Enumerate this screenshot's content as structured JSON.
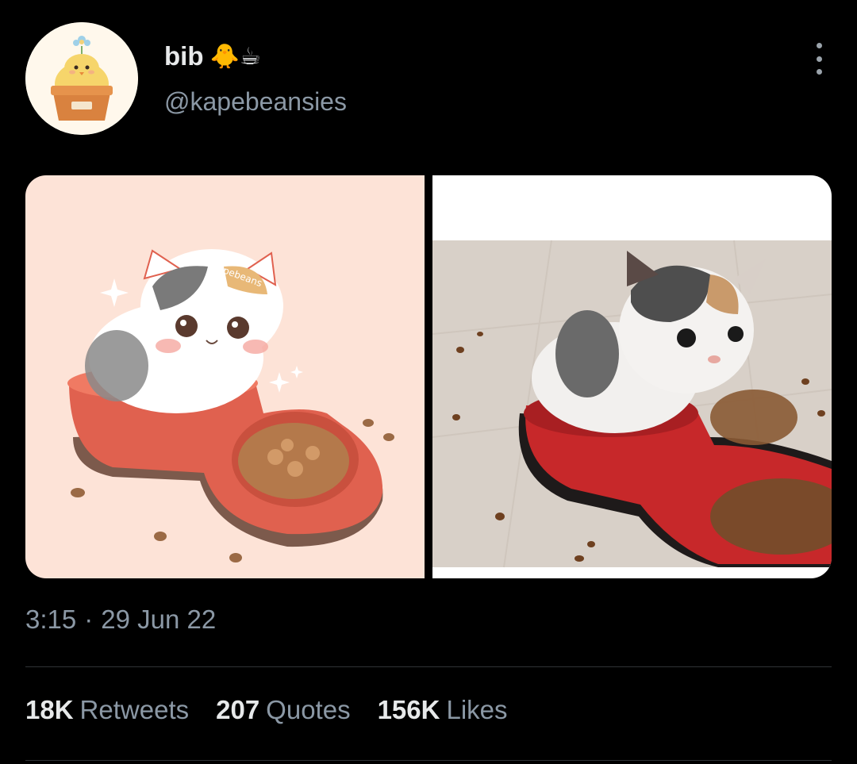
{
  "author": {
    "display_name": "bib",
    "name_emoji": "🐥☕",
    "handle": "@kapebeansies",
    "avatar_icon": "chick-in-flowerpot-avatar"
  },
  "media": {
    "left_image": "calico-kitten-illustration-in-red-bowl",
    "left_watermark": "kapebeans",
    "right_image": "calico-kitten-photo-in-red-bowl"
  },
  "timestamp": {
    "time": "3:15",
    "separator": "·",
    "date": "29 Jun 22"
  },
  "stats": [
    {
      "count": "18K",
      "label": "Retweets"
    },
    {
      "count": "207",
      "label": "Quotes"
    },
    {
      "count": "156K",
      "label": "Likes"
    }
  ],
  "colors": {
    "background": "#000000",
    "primary_text": "#e7e9ea",
    "secondary_text": "#8b98a5",
    "divider": "#2f3336"
  }
}
